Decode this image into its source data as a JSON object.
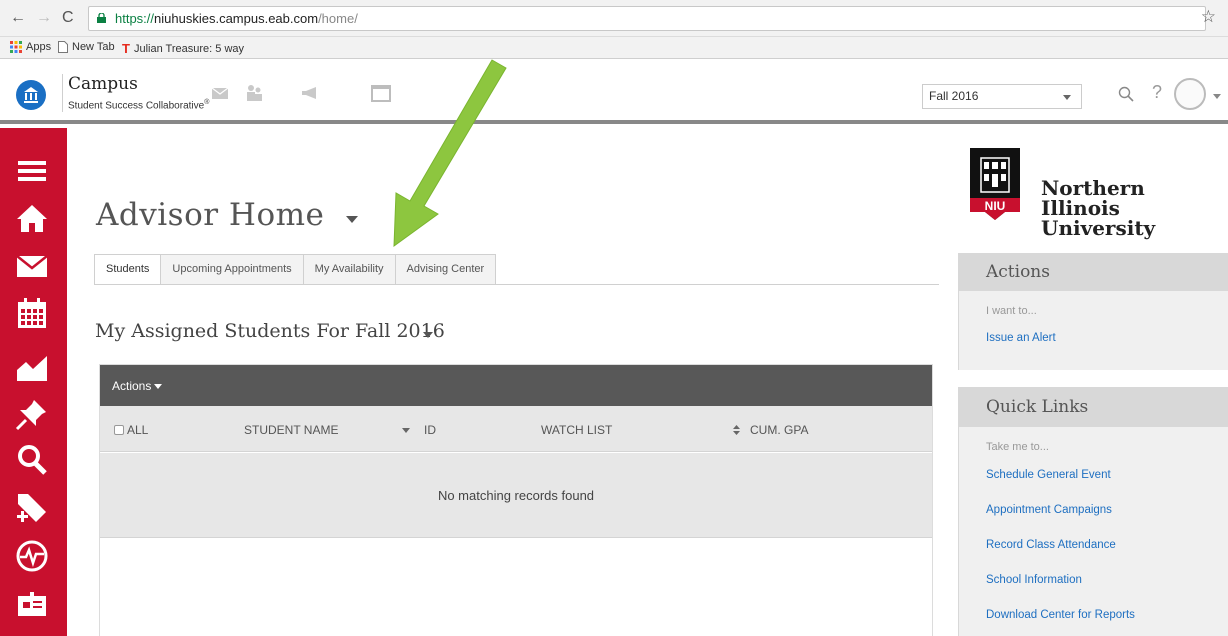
{
  "browser": {
    "url_scheme": "https://",
    "url_host": "niuhuskies.campus.eab.com",
    "url_path": "/home/",
    "bookmarks": [
      {
        "label": "Apps",
        "icon": "apps-grid-icon"
      },
      {
        "label": "New Tab",
        "icon": "page-icon"
      },
      {
        "label": "Julian Treasure: 5 way",
        "icon": "ted-icon"
      }
    ]
  },
  "header": {
    "brand_name": "Campus",
    "brand_sub": "Student Success Collaborative",
    "brand_mark": "®",
    "term": "Fall 2016"
  },
  "main": {
    "title": "Advisor Home",
    "tabs": [
      {
        "label": "Students",
        "active": true
      },
      {
        "label": "Upcoming Appointments",
        "active": false
      },
      {
        "label": "My Availability",
        "active": false
      },
      {
        "label": "Advising Center",
        "active": false
      }
    ],
    "section_title": "My Assigned Students For Fall 2016",
    "actions_label": "Actions",
    "columns": {
      "all": "ALL",
      "student_name": "STUDENT NAME",
      "id": "ID",
      "watch_list": "WATCH LIST",
      "cum_gpa": "CUM. GPA"
    },
    "empty_message": "No matching records found"
  },
  "right": {
    "university_line1": "Northern Illinois",
    "university_line2": "University",
    "logo_text": "NIU",
    "actions_panel": {
      "title": "Actions",
      "sub": "I want to...",
      "links": [
        "Issue an Alert"
      ]
    },
    "quicklinks_panel": {
      "title": "Quick Links",
      "sub": "Take me to...",
      "links": [
        "Schedule General Event",
        "Appointment Campaigns",
        "Record Class Attendance",
        "School Information",
        "Download Center for Reports"
      ]
    }
  },
  "colors": {
    "sidebar_red": "#c8102e",
    "link_blue": "#1e6fc1",
    "annotation_arrow": "#8dc63f"
  }
}
